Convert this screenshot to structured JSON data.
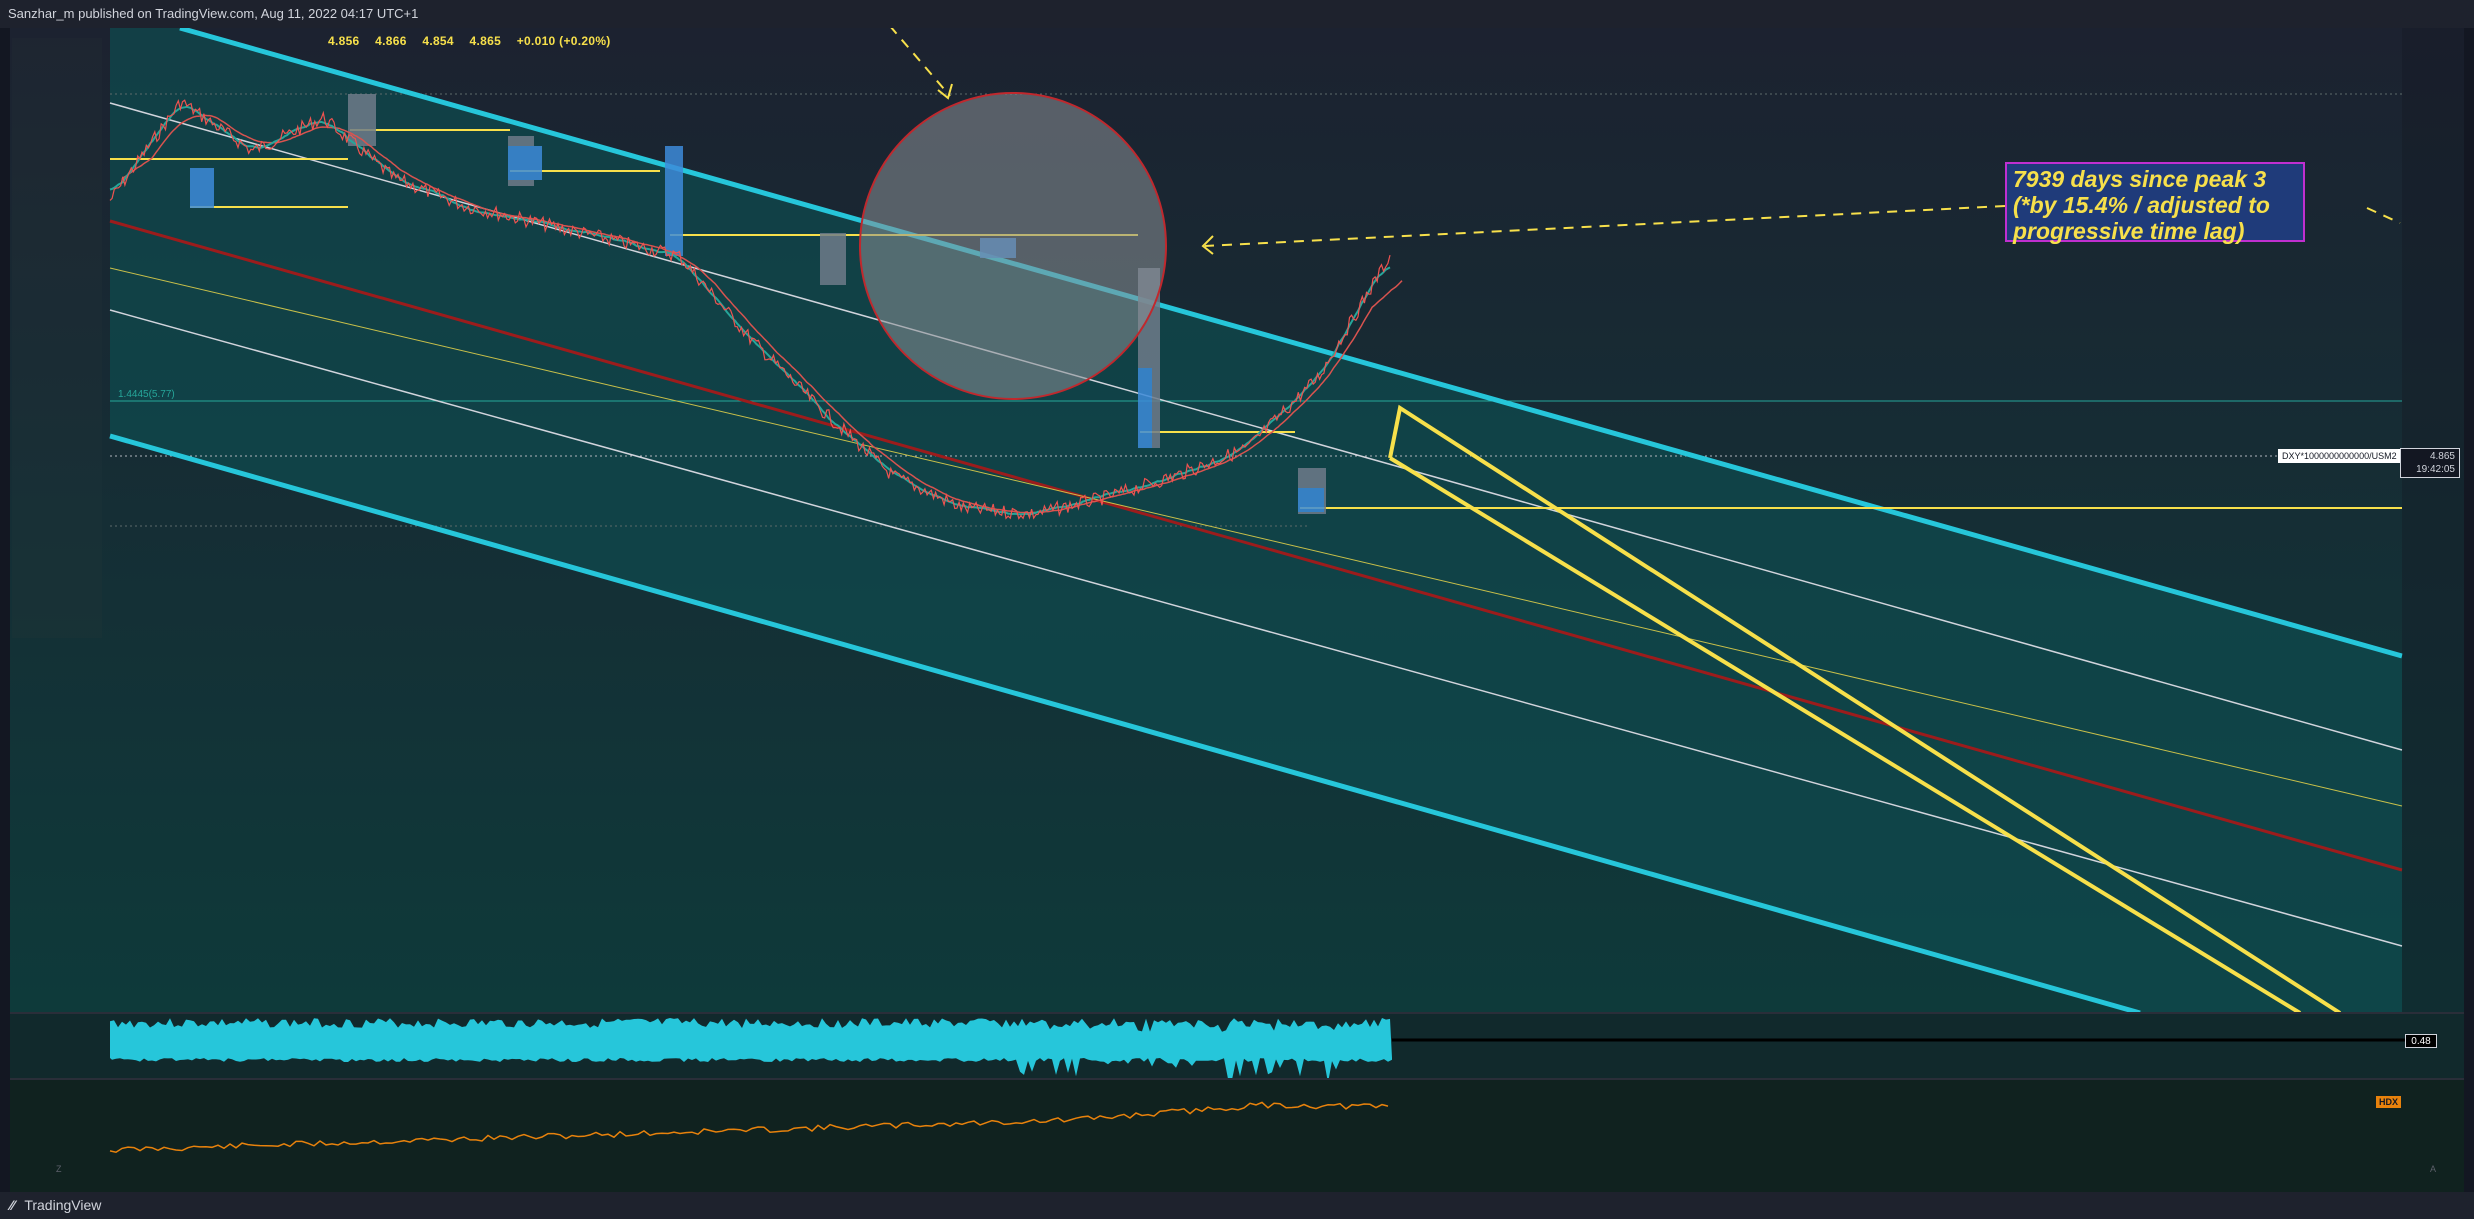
{
  "header": {
    "published": "Sanzhar_m published on TradingView.com, Aug 11, 2022 04:17 UTC+1"
  },
  "ohlc": {
    "open": "4.856",
    "high": "4.866",
    "low": "4.854",
    "close": "4.865",
    "change": "+0.010 (+0.20%)"
  },
  "annotation": {
    "line1": "7939 days since peak 3",
    "line2": "(*by 15.4% / adjusted to",
    "line3": "progressive time lag)"
  },
  "price_axis": {
    "symbol_tag": "DXY*1000000000000/USM2",
    "last_price": "4.865",
    "countdown": "19:42:05"
  },
  "oscillator": {
    "value": "0.48"
  },
  "lower_pane": {
    "tag": "HDX"
  },
  "footer": {
    "brand": "TradingView"
  },
  "colors": {
    "background": "#131722",
    "channel_fill": "#0f4a4e",
    "channel_edge": "#26c6da",
    "median_red": "#9c1c1c",
    "yellow": "#f7e04b",
    "white_line": "#d1d4dc",
    "oscillator": "#26c6da",
    "lower_line": "#e8820c"
  },
  "chart_data": {
    "type": "line",
    "title": "",
    "symbol": "DXY*1000000000000/USM2",
    "last": 4.865,
    "price_path_shape": [
      5,
      23,
      14,
      20,
      9,
      4,
      1,
      -2,
      -5,
      -20,
      -33,
      -45,
      -51,
      -52,
      -49,
      -45,
      -40,
      -27,
      -5
    ],
    "oscillator_value": 0.48
  }
}
